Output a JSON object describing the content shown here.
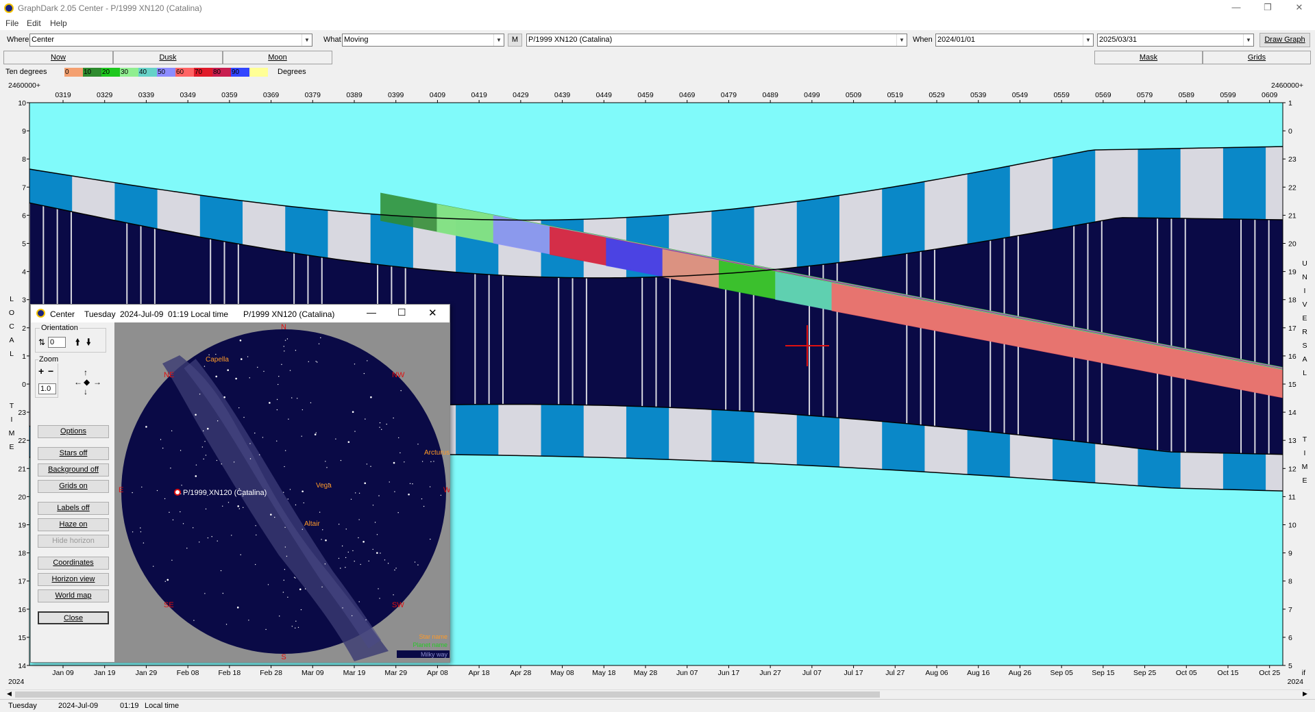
{
  "window": {
    "title": "GraphDark 2.05  Center  -  P/1999 XN120 (Catalina)"
  },
  "menu": [
    "File",
    "Edit",
    "Help"
  ],
  "toolbar": {
    "where_label": "Where",
    "where_value": "Center",
    "what_label": "What",
    "what_value": "Moving",
    "m_button": "M",
    "object_value": "P/1999 XN120 (Catalina)",
    "when_label": "When",
    "from_date": "2024/01/01",
    "to_date": "2025/03/31",
    "draw_button": "Draw Graph"
  },
  "tabs": {
    "now": "Now",
    "dusk": "Dusk",
    "moon": "Moon",
    "mask": "Mask",
    "grids": "Grids"
  },
  "legend": {
    "label": "Ten degrees",
    "unit": "Degrees",
    "steps": [
      {
        "v": "0",
        "c": "#f4a070"
      },
      {
        "v": "10",
        "c": "#2e8b2e"
      },
      {
        "v": "20",
        "c": "#1ec81e"
      },
      {
        "v": "30",
        "c": "#90ee90"
      },
      {
        "v": "40",
        "c": "#66d2c8"
      },
      {
        "v": "50",
        "c": "#8c8cff"
      },
      {
        "v": "60",
        "c": "#ff6464"
      },
      {
        "v": "70",
        "c": "#e01b2a"
      },
      {
        "v": "80",
        "c": "#c81e50"
      },
      {
        "v": "90",
        "c": "#3246ff"
      },
      {
        "v": "",
        "c": "#ffff96"
      }
    ]
  },
  "graph": {
    "jd_left": "2460000+",
    "jd_right": "2460000+",
    "jd_ticks": [
      "0319",
      "0329",
      "0339",
      "0349",
      "0359",
      "0369",
      "0379",
      "0389",
      "0399",
      "0409",
      "0419",
      "0429",
      "0439",
      "0449",
      "0459",
      "0469",
      "0479",
      "0489",
      "0499",
      "0509",
      "0519",
      "0529",
      "0539",
      "0549",
      "0559",
      "0569",
      "0579",
      "0589",
      "0599",
      "0609"
    ],
    "date_ticks": [
      "Jan 09",
      "Jan 19",
      "Jan 29",
      "Feb 08",
      "Feb 18",
      "Feb 28",
      "Mar 09",
      "Mar 19",
      "Mar 29",
      "Apr 08",
      "Apr 18",
      "Apr 28",
      "May 08",
      "May 18",
      "May 28",
      "Jun 07",
      "Jun 17",
      "Jun 27",
      "Jul 07",
      "Jul 17",
      "Jul 27",
      "Aug 06",
      "Aug 16",
      "Aug 26",
      "Sep 05",
      "Sep 15",
      "Sep 25",
      "Oct 05",
      "Oct 15",
      "Oct 25"
    ],
    "year_left": "2024",
    "year_right": "2024",
    "right_corner": "if",
    "left_axis": [
      "10",
      "9",
      "8",
      "7",
      "6",
      "5",
      "4",
      "3",
      "2",
      "1",
      "0",
      "23",
      "22",
      "21",
      "20",
      "19",
      "18",
      "17",
      "16",
      "15",
      "14"
    ],
    "right_axis": [
      "1",
      "0",
      "23",
      "22",
      "21",
      "20",
      "19",
      "18",
      "17",
      "16",
      "15",
      "14",
      "13",
      "12",
      "11",
      "10",
      "9",
      "8",
      "7",
      "6",
      "5"
    ],
    "left_title": "LOCAL TIME",
    "right_title": "UNIVERSAL TIME",
    "colors": {
      "sky": "#80fafa",
      "night": "#0a0a46",
      "twilight": "#0a88c8",
      "moon": "#d8d8e0"
    }
  },
  "status": {
    "day": "Tuesday",
    "date": "2024-Jul-09",
    "time": "01:19",
    "zone": "Local time"
  },
  "popup": {
    "title_place": "Center",
    "title_day": "Tuesday",
    "title_date": "2024-Jul-09",
    "title_time": "01:19 Local time",
    "title_object": "P/1999 XN120 (Catalina)",
    "orientation_label": "Orientation",
    "orientation_value": "0",
    "zoom_label": "Zoom",
    "zoom_value": "1.0",
    "buttons": {
      "options": "Options",
      "stars": "Stars off",
      "background": "Background off",
      "grids": "Grids on",
      "labels": "Labels off",
      "haze": "Haze on",
      "hide_horizon": "Hide horizon",
      "coordinates": "Coordinates",
      "horizon_view": "Horizon view",
      "world_map": "World map",
      "close": "Close"
    },
    "compass": {
      "n": "N",
      "ne": "NE",
      "nw": "NW",
      "e": "E",
      "w": "W",
      "se": "SE",
      "sw": "SW",
      "s": "S"
    },
    "stars": {
      "capella": "Capella",
      "vega": "Vega",
      "altair": "Altair",
      "arcturus": "Arcturus"
    },
    "target": "P/1999 XN120 (Catalina)",
    "key": {
      "star": "Star name",
      "planet": "Planet name",
      "milky": "Milky way"
    }
  }
}
